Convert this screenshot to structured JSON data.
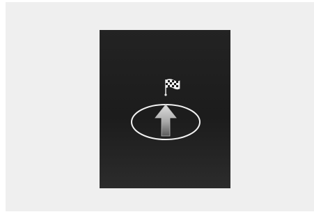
{
  "screen": {
    "icons": {
      "destination": "checkered-flag-icon",
      "direction": "straight-ahead-arrow-icon",
      "marker": "position-ellipse"
    },
    "colors": {
      "background": "#efefef",
      "display": "#1f1f1f",
      "outline": "#f2f2f2",
      "arrow_light": "#d8d8d8",
      "arrow_dark": "#5e5e5e"
    }
  }
}
